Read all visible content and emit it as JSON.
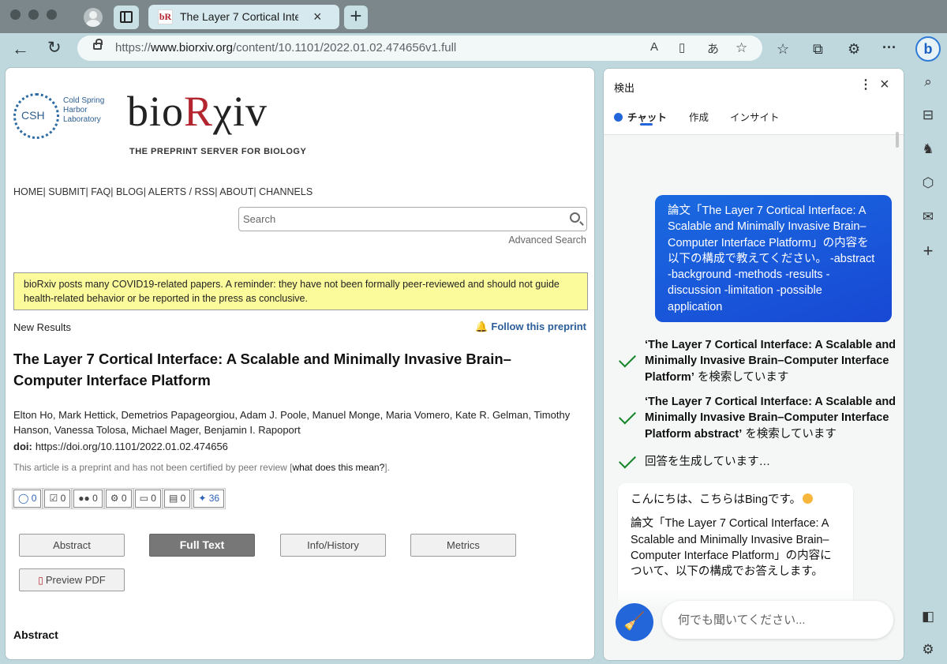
{
  "tab": {
    "title": "The Layer 7 Cortical Interface: A Scalable",
    "favicon": "bR"
  },
  "address": {
    "url_prefix": "https://",
    "url_host": "www.biorxiv.org",
    "url_path": "/content/10.1101/2022.01.02.474656v1.full"
  },
  "toolbar_icons": {
    "back": "←",
    "reload": "↻",
    "read_aloud": "A",
    "favorites": "☆",
    "more": "···"
  },
  "site": {
    "csh_logo": "CSH",
    "csh_name": "Cold Spring Harbor Laboratory",
    "logo_text_a": "bio",
    "logo_text_b": "R",
    "logo_text_c": "χiv",
    "tagline": "THE PREPRINT SERVER FOR BIOLOGY",
    "nav": [
      "HOME",
      "SUBMIT",
      "FAQ",
      "BLOG",
      "ALERTS / RSS",
      "ABOUT",
      "CHANNELS"
    ],
    "search_placeholder": "Search",
    "advanced_search": "Advanced Search",
    "covid_notice": "bioRxiv posts many COVID19-related papers. A reminder: they have not been formally peer-reviewed and should not guide health-related behavior or be reported in the press as conclusive."
  },
  "article": {
    "section": "New Results",
    "follow": "Follow this preprint",
    "title": "The Layer 7 Cortical Interface: A Scalable and Minimally Invasive Brain–Computer Interface Platform",
    "authors": "Elton Ho, Mark Hettick, Demetrios Papageorgiou, Adam J. Poole, Manuel Monge, Maria Vomero, Kate R. Gelman, Timothy Hanson, Vanessa Tolosa, Michael Mager, Benjamin I. Rapoport",
    "doi_label": "doi:",
    "doi": "https://doi.org/10.1101/2022.01.02.474656",
    "preprint_note": "This article is a preprint and has not been certified by peer review [",
    "preprint_link": "what does this mean?",
    "preprint_end": "].",
    "metrics": [
      {
        "icon": "comment-icon",
        "glyph": "💬",
        "value": "0"
      },
      {
        "icon": "checklist-icon",
        "glyph": "☑",
        "value": "0"
      },
      {
        "icon": "users-icon",
        "glyph": "👥",
        "value": "0"
      },
      {
        "icon": "gears-icon",
        "glyph": "⚙",
        "value": "0"
      },
      {
        "icon": "monitor-icon",
        "glyph": "🖥",
        "value": "0"
      },
      {
        "icon": "film-icon",
        "glyph": "🎞",
        "value": "0"
      },
      {
        "icon": "twitter-icon",
        "glyph": "🐦",
        "value": "36"
      }
    ],
    "tabs": [
      "Abstract",
      "Full Text",
      "Info/History",
      "Metrics"
    ],
    "preview_pdf": "Preview PDF",
    "abstract_heading": "Abstract"
  },
  "chat": {
    "title": "検出",
    "tabs": [
      "チャット",
      "作成",
      "インサイト"
    ],
    "user_message": "論文「The Layer 7 Cortical Interface: A Scalable and Minimally Invasive Brain–Computer Interface Platform」の内容を以下の構成で教えてください。 -abstract -background -methods -results -discussion -limitation -possible application",
    "steps": [
      {
        "bold": "‘The Layer 7 Cortical Interface: A Scalable and Minimally Invasive Brain–Computer Interface Platform’",
        "rest": " を検索しています"
      },
      {
        "bold": "‘The Layer 7 Cortical Interface: A Scalable and Minimally Invasive Brain–Computer Interface Platform abstract’",
        "rest": " を検索しています"
      },
      {
        "bold": "",
        "rest": "回答を生成しています…"
      }
    ],
    "bot_greeting": "こんにちは、こちらはBingです。",
    "bot_message": "論文「The Layer 7 Cortical Interface: A Scalable and Minimally Invasive Brain–Computer Interface Platform」の内容について、以下の構成でお答えします。",
    "input_placeholder": "何でも聞いてください..."
  }
}
